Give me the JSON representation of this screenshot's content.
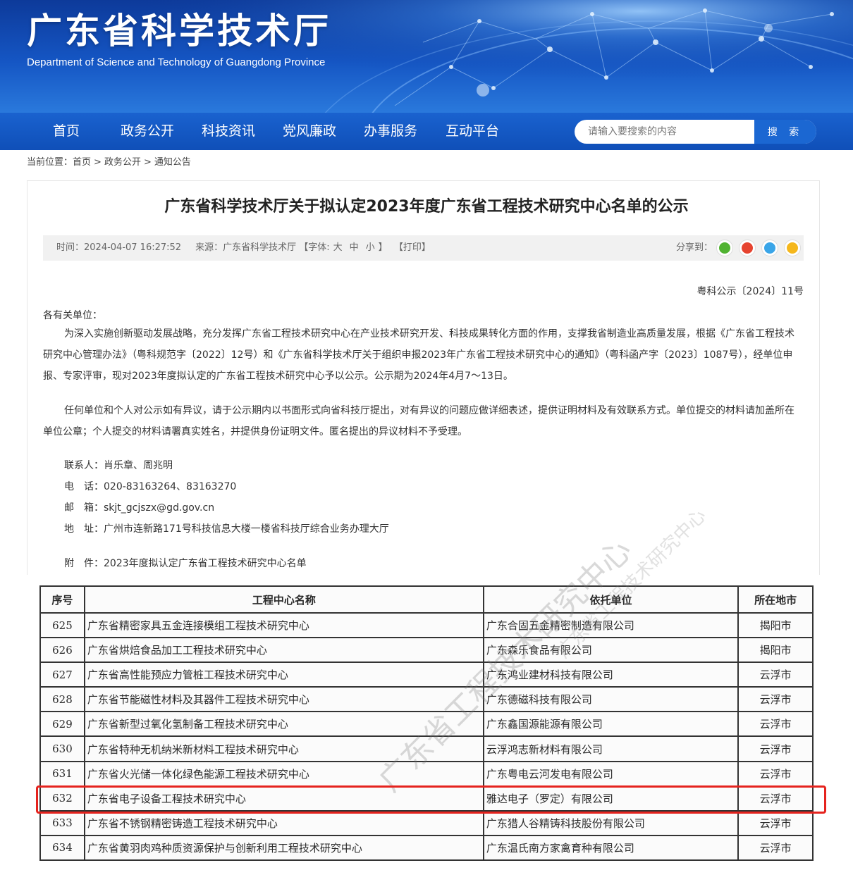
{
  "header": {
    "title": "广东省科学技术厅",
    "subtitle": "Department of Science and Technology of Guangdong Province"
  },
  "nav": {
    "items": [
      "首页",
      "政务公开",
      "科技资讯",
      "党风廉政",
      "办事服务",
      "互动平台"
    ],
    "search_placeholder": "请输入要搜索的内容",
    "search_button": "搜 索"
  },
  "breadcrumb": {
    "prefix": "当前位置：",
    "items": [
      "首页",
      "政务公开",
      "通知公告"
    ],
    "separator": ">"
  },
  "article": {
    "title": "广东省科学技术厅关于拟认定2023年度广东省工程技术研究中心名单的公示",
    "meta": {
      "time": "时间：2024-04-07 16:27:52",
      "source": "来源：广东省科学技术厅",
      "font_label": "【字体:",
      "font_large": "大",
      "font_medium": "中",
      "font_small": "小",
      "font_close": "】",
      "print": "【打印】",
      "share_label": "分享到："
    },
    "share_icons": [
      {
        "name": "wechat-icon",
        "color": "#51b332"
      },
      {
        "name": "weibo-icon",
        "color": "#e6432f"
      },
      {
        "name": "qq-icon",
        "color": "#3aa5e8"
      },
      {
        "name": "qzone-icon",
        "color": "#f5b71c"
      }
    ],
    "doc_number": "粤科公示〔2024〕11号",
    "salutation": "各有关单位：",
    "paragraph1": "为深入实施创新驱动发展战略，充分发挥广东省工程技术研究中心在产业技术研究开发、科技成果转化方面的作用，支撑我省制造业高质量发展，根据《广东省工程技术研究中心管理办法》（粤科规范字〔2022〕12号）和《广东省科学技术厅关于组织申报2023年广东省工程技术研究中心的通知》（粤科函产字〔2023〕1087号），经单位申报、专家评审，现对2023年度拟认定的广东省工程技术研究中心予以公示。公示期为2024年4月7～13日。",
    "paragraph2": "任何单位和个人对公示如有异议，请于公示期内以书面形式向省科技厅提出，对有异议的问题应做详细表述，提供证明材料及有效联系方式。单位提交的材料请加盖所在单位公章；个人提交的材料请署真实姓名，并提供身份证明文件。匿名提出的异议材料不予受理。",
    "contacts": {
      "person": "联系人：肖乐章、周兆明",
      "phone": "电　话：020-83163264、83163270",
      "email": "邮　箱：skjt_gcjszx@gd.gov.cn",
      "address": "地　址：广州市连新路171号科技信息大楼一楼省科技厅综合业务办理大厅",
      "attachment": "附　件：2023年度拟认定广东省工程技术研究中心名单"
    }
  },
  "table": {
    "headers": [
      "序号",
      "工程中心名称",
      "依托单位",
      "所在地市"
    ],
    "rows": [
      [
        "625",
        "广东省精密家具五金连接模组工程技术研究中心",
        "广东合固五金精密制造有限公司",
        "揭阳市"
      ],
      [
        "626",
        "广东省烘焙食品加工工程技术研究中心",
        "广东森乐食品有限公司",
        "揭阳市"
      ],
      [
        "627",
        "广东省高性能预应力管桩工程技术研究中心",
        "广东鸿业建材科技有限公司",
        "云浮市"
      ],
      [
        "628",
        "广东省节能磁性材料及其器件工程技术研究中心",
        "广东德磁科技有限公司",
        "云浮市"
      ],
      [
        "629",
        "广东省新型过氧化氢制备工程技术研究中心",
        "广东鑫国源能源有限公司",
        "云浮市"
      ],
      [
        "630",
        "广东省特种无机纳米新材料工程技术研究中心",
        "云浮鸿志新材料有限公司",
        "云浮市"
      ],
      [
        "631",
        "广东省火光储一体化绿色能源工程技术研究中心",
        "广东粤电云河发电有限公司",
        "云浮市"
      ],
      [
        "632",
        "广东省电子设备工程技术研究中心",
        "雅达电子（罗定）有限公司",
        "云浮市"
      ],
      [
        "633",
        "广东省不锈钢精密铸造工程技术研究中心",
        "广东猎人谷精铸科技股份有限公司",
        "云浮市"
      ],
      [
        "634",
        "广东省黄羽肉鸡种质资源保护与创新利用工程技术研究中心",
        "广东温氏南方家禽育种有限公司",
        "云浮市"
      ]
    ],
    "highlighted_row": "632",
    "highlight_color": "#e5231e",
    "watermark": "广东省工程技术研究中心"
  }
}
